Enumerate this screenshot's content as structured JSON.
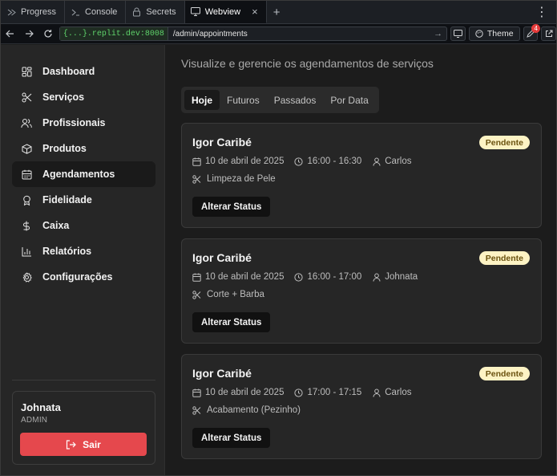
{
  "browser": {
    "tabs": [
      {
        "label": "Progress",
        "icon": "progress-icon"
      },
      {
        "label": "Console",
        "icon": "terminal-icon"
      },
      {
        "label": "Secrets",
        "icon": "lock-icon"
      },
      {
        "label": "Webview",
        "icon": "monitor-icon",
        "active": true
      }
    ],
    "url_host": "{...}.replit.dev:8008",
    "url_path": "/admin/appointments",
    "theme_label": "Theme",
    "notifications_count": "4"
  },
  "sidebar": {
    "items": [
      {
        "label": "Dashboard",
        "icon": "dashboard-icon"
      },
      {
        "label": "Serviços",
        "icon": "scissors-icon"
      },
      {
        "label": "Profissionais",
        "icon": "users-icon"
      },
      {
        "label": "Produtos",
        "icon": "box-icon"
      },
      {
        "label": "Agendamentos",
        "icon": "calendar-icon",
        "active": true
      },
      {
        "label": "Fidelidade",
        "icon": "award-icon"
      },
      {
        "label": "Caixa",
        "icon": "dollar-icon"
      },
      {
        "label": "Relatórios",
        "icon": "bar-chart-icon"
      },
      {
        "label": "Configurações",
        "icon": "settings-icon"
      }
    ],
    "user": {
      "name": "Johnata",
      "role": "ADMIN"
    },
    "logout_label": "Sair"
  },
  "main": {
    "subtitle": "Visualize e gerencie os agendamentos de serviços",
    "tabs": [
      {
        "label": "Hoje",
        "active": true
      },
      {
        "label": "Futuros"
      },
      {
        "label": "Passados"
      },
      {
        "label": "Por Data"
      }
    ],
    "appointments": [
      {
        "client": "Igor Caribé",
        "status": "Pendente",
        "date": "10 de abril de 2025",
        "time": "16:00 - 16:30",
        "professional": "Carlos",
        "service": "Limpeza de Pele",
        "action": "Alterar Status"
      },
      {
        "client": "Igor Caribé",
        "status": "Pendente",
        "date": "10 de abril de 2025",
        "time": "16:00 - 17:00",
        "professional": "Johnata",
        "service": "Corte + Barba",
        "action": "Alterar Status"
      },
      {
        "client": "Igor Caribé",
        "status": "Pendente",
        "date": "10 de abril de 2025",
        "time": "17:00 - 17:15",
        "professional": "Carlos",
        "service": "Acabamento (Pezinho)",
        "action": "Alterar Status"
      }
    ]
  },
  "colors": {
    "accent_danger": "#e5484d",
    "status_pending_bg": "#fdf3c4",
    "status_pending_text": "#6b5310",
    "url_host_green": "#5fd36b"
  }
}
